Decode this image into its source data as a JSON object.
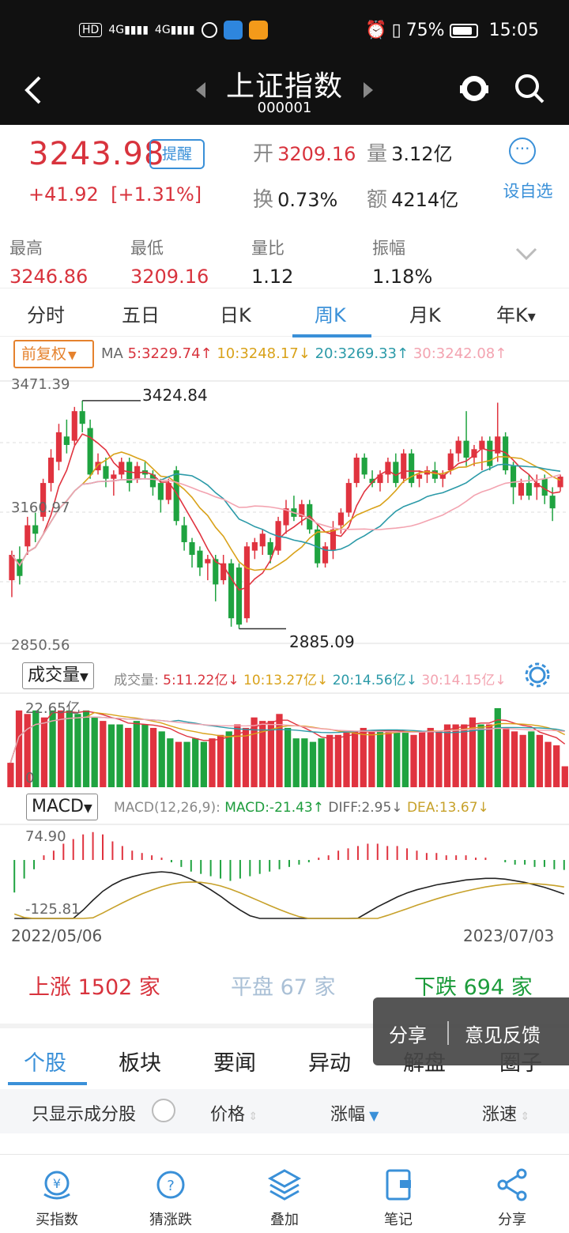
{
  "status_bar": {
    "left": [
      "HD",
      "4G",
      "4G"
    ],
    "battery": "75%",
    "time": "15:05"
  },
  "title_bar": {
    "title": "上证指数",
    "code": "000001"
  },
  "quote": {
    "price": "3243.98",
    "remind_label": "提醒",
    "change": "+41.92",
    "change_pct": "[+1.31%]",
    "open_label": "开",
    "open": "3209.16",
    "volume_label": "量",
    "volume": "3.12亿",
    "turnover_label": "换",
    "turnover": "0.73%",
    "amount_label": "额",
    "amount": "4214亿",
    "fav_label": "设自选",
    "stats": [
      {
        "label": "最高",
        "value": "3246.86",
        "color": "#d8333d"
      },
      {
        "label": "最低",
        "value": "3209.16",
        "color": "#d8333d"
      },
      {
        "label": "量比",
        "value": "1.12",
        "color": "#222222"
      },
      {
        "label": "振幅",
        "value": "1.18%",
        "color": "#222222"
      }
    ]
  },
  "tabs": [
    "分时",
    "五日",
    "日K",
    "周K",
    "月K",
    "年K"
  ],
  "active_tab": "周K",
  "ma_bar": {
    "adjust_label": "前复权",
    "ma_label": "MA",
    "ma5": "5:3229.74↑",
    "ma10": "10:3248.17↓",
    "ma20": "20:3269.33↑",
    "ma30": "30:3242.08↑"
  },
  "kline": {
    "ytop": "3471.39",
    "ymid": "3160.97",
    "ybot": "2850.56",
    "high_mark": "3424.84",
    "low_mark": "2885.09"
  },
  "volume_bar": {
    "button": "成交量",
    "label": "成交量:",
    "v5": "5:11.22亿↓",
    "v10": "10:13.27亿↓",
    "v20": "20:14.56亿↓",
    "v30": "30:14.15亿↓",
    "ymax": "22.65亿",
    "yzero": "0"
  },
  "macd_bar": {
    "button": "MACD",
    "params": "MACD(12,26,9):",
    "macd": "MACD:-21.43↑",
    "diff": "DIFF:2.95↓",
    "dea": "DEA:13.67↓",
    "ymax": "74.90",
    "ymin": "-125.81"
  },
  "dates": {
    "start": "2022/05/06",
    "end": "2023/07/03"
  },
  "market_breadth": {
    "up_label": "上涨",
    "up_count": "1502",
    "up_unit": "家",
    "flat_label": "平盘",
    "flat_count": "67",
    "flat_unit": "家",
    "down_label": "下跌",
    "down_count": "694",
    "down_unit": "家"
  },
  "share_popup": {
    "share": "分享",
    "feedback": "意见反馈"
  },
  "bottom_tabs": [
    "个股",
    "板块",
    "要闻",
    "异动",
    "解盘",
    "圈子"
  ],
  "filter_row": {
    "only_components": "只显示成分股",
    "price": "价格",
    "change_pct": "涨幅",
    "speed": "涨速"
  },
  "bottom_nav": [
    {
      "label": "买指数",
      "icon": "buy-index-icon"
    },
    {
      "label": "猜涨跌",
      "icon": "guess-icon"
    },
    {
      "label": "叠加",
      "icon": "layers-icon"
    },
    {
      "label": "笔记",
      "icon": "note-icon"
    },
    {
      "label": "分享",
      "icon": "share-icon"
    }
  ],
  "chart_data": {
    "type": "candlestick",
    "title": "",
    "x_range": [
      "2022/05/06",
      "2023/07/03"
    ],
    "ylim": [
      2850.56,
      3471.39
    ],
    "candles": [
      [
        3000,
        3060,
        2960,
        3070
      ],
      [
        3050,
        3010,
        2990,
        3080
      ],
      [
        3080,
        3130,
        3060,
        3150
      ],
      [
        3130,
        3110,
        3090,
        3160
      ],
      [
        3150,
        3230,
        3140,
        3240
      ],
      [
        3230,
        3290,
        3210,
        3310
      ],
      [
        3280,
        3350,
        3260,
        3370
      ],
      [
        3340,
        3320,
        3300,
        3380
      ],
      [
        3330,
        3400,
        3320,
        3410
      ],
      [
        3400,
        3370,
        3350,
        3424.84
      ],
      [
        3360,
        3250,
        3240,
        3380
      ],
      [
        3260,
        3280,
        3250,
        3300
      ],
      [
        3270,
        3240,
        3220,
        3290
      ],
      [
        3240,
        3250,
        3200,
        3260
      ],
      [
        3250,
        3280,
        3240,
        3290
      ],
      [
        3280,
        3230,
        3210,
        3290
      ],
      [
        3240,
        3270,
        3230,
        3280
      ],
      [
        3260,
        3250,
        3240,
        3280
      ],
      [
        3250,
        3220,
        3200,
        3260
      ],
      [
        3230,
        3190,
        3160,
        3240
      ],
      [
        3190,
        3230,
        3180,
        3240
      ],
      [
        3260,
        3140,
        3130,
        3270
      ],
      [
        3130,
        3090,
        3070,
        3150
      ],
      [
        3090,
        3060,
        3030,
        3100
      ],
      [
        3070,
        3030,
        3010,
        3080
      ],
      [
        3040,
        3050,
        3000,
        3060
      ],
      [
        3050,
        2990,
        2950,
        3060
      ],
      [
        3000,
        3040,
        2990,
        3060
      ],
      [
        3040,
        2910,
        2890,
        3050
      ],
      [
        3030,
        2895,
        2885.09,
        3040
      ],
      [
        2910,
        3080,
        2900,
        3090
      ],
      [
        3070,
        3090,
        3050,
        3100
      ],
      [
        3080,
        3110,
        3060,
        3120
      ],
      [
        3090,
        3060,
        3040,
        3100
      ],
      [
        3070,
        3140,
        3060,
        3150
      ],
      [
        3130,
        3170,
        3110,
        3190
      ],
      [
        3170,
        3150,
        3140,
        3200
      ],
      [
        3150,
        3180,
        3130,
        3190
      ],
      [
        3180,
        3120,
        3110,
        3190
      ],
      [
        3120,
        3040,
        3030,
        3130
      ],
      [
        3040,
        3080,
        3030,
        3090
      ],
      [
        3070,
        3120,
        3050,
        3140
      ],
      [
        3130,
        3160,
        3110,
        3170
      ],
      [
        3160,
        3230,
        3150,
        3240
      ],
      [
        3230,
        3290,
        3220,
        3300
      ],
      [
        3290,
        3250,
        3240,
        3300
      ],
      [
        3240,
        3230,
        3220,
        3260
      ],
      [
        3230,
        3250,
        3210,
        3260
      ],
      [
        3250,
        3280,
        3230,
        3290
      ],
      [
        3280,
        3230,
        3220,
        3300
      ],
      [
        3240,
        3300,
        3230,
        3310
      ],
      [
        3300,
        3230,
        3220,
        3310
      ],
      [
        3240,
        3250,
        3220,
        3260
      ],
      [
        3250,
        3260,
        3230,
        3270
      ],
      [
        3260,
        3240,
        3230,
        3280
      ],
      [
        3240,
        3250,
        3220,
        3260
      ],
      [
        3260,
        3300,
        3250,
        3310
      ],
      [
        3300,
        3330,
        3280,
        3340
      ],
      [
        3330,
        3290,
        3270,
        3400
      ],
      [
        3290,
        3310,
        3270,
        3320
      ],
      [
        3310,
        3330,
        3260,
        3340
      ],
      [
        3330,
        3270,
        3260,
        3340
      ],
      [
        3300,
        3340,
        3280,
        3420
      ],
      [
        3340,
        3260,
        3250,
        3350
      ],
      [
        3270,
        3220,
        3180,
        3280
      ],
      [
        3200,
        3230,
        3190,
        3240
      ],
      [
        3230,
        3200,
        3190,
        3250
      ],
      [
        3220,
        3230,
        3190,
        3250
      ],
      [
        3240,
        3200,
        3180,
        3250
      ],
      [
        3200,
        3170,
        3140,
        3220
      ],
      [
        3220,
        3245,
        3210,
        3250
      ]
    ],
    "volumes": [
      [
        7,
        1
      ],
      [
        22,
        1
      ],
      [
        21,
        1
      ],
      [
        22,
        0
      ],
      [
        20,
        1
      ],
      [
        22,
        0
      ],
      [
        22,
        1
      ],
      [
        22,
        0
      ],
      [
        21,
        0
      ],
      [
        22,
        0
      ],
      [
        20,
        0
      ],
      [
        19,
        1
      ],
      [
        18,
        0
      ],
      [
        18,
        0
      ],
      [
        17,
        1
      ],
      [
        19,
        0
      ],
      [
        18,
        0
      ],
      [
        17,
        1
      ],
      [
        16,
        0
      ],
      [
        14,
        0
      ],
      [
        13,
        1
      ],
      [
        13,
        0
      ],
      [
        14,
        0
      ],
      [
        13,
        0
      ],
      [
        14,
        1
      ],
      [
        15,
        1
      ],
      [
        16,
        0
      ],
      [
        18,
        1
      ],
      [
        17,
        1
      ],
      [
        20,
        1
      ],
      [
        19,
        1
      ],
      [
        19,
        1
      ],
      [
        21,
        1
      ],
      [
        17,
        0
      ],
      [
        14,
        0
      ],
      [
        14,
        0
      ],
      [
        13,
        0
      ],
      [
        14,
        0
      ],
      [
        15,
        1
      ],
      [
        15,
        1
      ],
      [
        16,
        1
      ],
      [
        16,
        1
      ],
      [
        17,
        1
      ],
      [
        16,
        1
      ],
      [
        16,
        0
      ],
      [
        16,
        1
      ],
      [
        16,
        0
      ],
      [
        16,
        0
      ],
      [
        15,
        1
      ],
      [
        16,
        1
      ],
      [
        17,
        1
      ],
      [
        16,
        1
      ],
      [
        18,
        1
      ],
      [
        18,
        1
      ],
      [
        18,
        1
      ],
      [
        20,
        1
      ],
      [
        18,
        0
      ],
      [
        18,
        1
      ],
      [
        22.65,
        0
      ],
      [
        17,
        1
      ],
      [
        16,
        1
      ],
      [
        15,
        1
      ],
      [
        16,
        0
      ],
      [
        15,
        1
      ],
      [
        13,
        1
      ],
      [
        12,
        1
      ],
      [
        6,
        1
      ]
    ],
    "macd": [
      -70,
      -40,
      -20,
      10,
      20,
      35,
      45,
      55,
      60,
      55,
      40,
      30,
      20,
      15,
      10,
      5,
      -5,
      -15,
      -25,
      -30,
      -35,
      -40,
      -45,
      -40,
      -35,
      -30,
      -25,
      -20,
      -15,
      -10,
      -5,
      5,
      10,
      20,
      25,
      30,
      35,
      35,
      30,
      30,
      25,
      20,
      15,
      15,
      10,
      10,
      10,
      5,
      5,
      0,
      -5,
      -10,
      -10,
      -15,
      -15,
      -20,
      -21.43
    ],
    "indicator_ylim": [
      -125.81,
      74.9
    ]
  }
}
